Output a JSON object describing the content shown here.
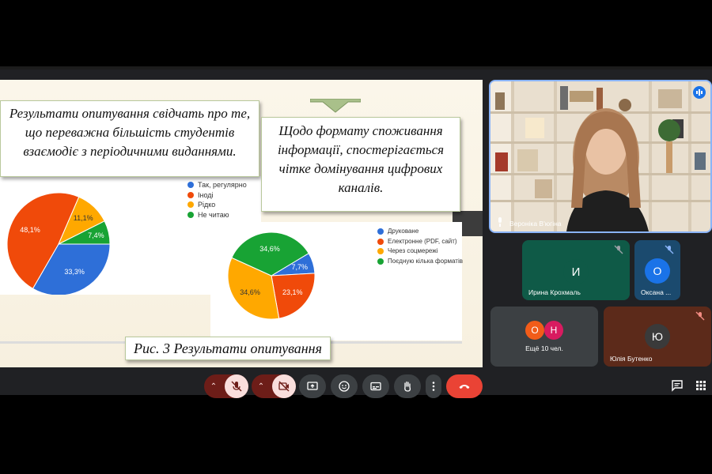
{
  "slide": {
    "box1_text": "Результати опитування свідчать про те, що переважна більшість студентів взаємодіє з періодичними виданнями.",
    "box2_text": "Щодо формату споживання інформації, спостерігається чітке домінування цифрових каналів.",
    "caption": "Рис. 3 Результати опитування"
  },
  "chart_data": [
    {
      "type": "pie",
      "categories": [
        "Так, регулярно",
        "Іноді",
        "Рідко",
        "Не читаю"
      ],
      "values": [
        33.3,
        48.1,
        11.1,
        7.4
      ],
      "labels": [
        "33,3%",
        "48,1%",
        "11,1%",
        "7,4%"
      ],
      "colors": [
        "#2e6fd8",
        "#f04a0a",
        "#ffa800",
        "#18a334"
      ],
      "legend": "right"
    },
    {
      "type": "pie",
      "categories": [
        "Друковане",
        "Електронне (PDF, сайт)",
        "Через соцмережі",
        "Поєдную кілька форматів"
      ],
      "values": [
        7.7,
        23.1,
        34.6,
        34.6
      ],
      "labels": [
        "7,7%",
        "23,1%",
        "34,6%",
        "34,6%"
      ],
      "colors": [
        "#2e6fd8",
        "#f04a0a",
        "#ffa800",
        "#18a334"
      ],
      "legend": "right"
    }
  ],
  "participants": {
    "speaker": "Вероніка В'югіна",
    "p1_initial": "И",
    "p1_name": "Ирина Крохмаль",
    "p2_initial": "О",
    "p2_name": "Оксана ...",
    "more_initial_a": "О",
    "more_initial_b": "Н",
    "more_label": "Ещё 10 чел.",
    "p3_initial": "Ю",
    "p3_name": "Юлія Бутенко"
  },
  "colors": {
    "end_call": "#ea4335",
    "muted_bg": "#f9dedc",
    "muted_dark": "#6d1d18"
  },
  "icons": [
    "mic-off-icon",
    "camera-off-icon",
    "present-icon",
    "emoji-icon",
    "captions-icon",
    "raise-hand-icon",
    "more-icon",
    "end-call-icon",
    "chat-icon",
    "apps-icon"
  ]
}
